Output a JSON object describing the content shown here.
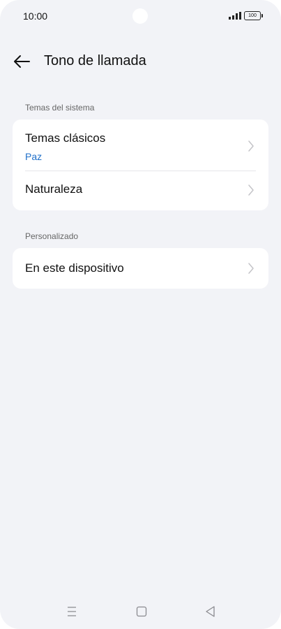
{
  "status_bar": {
    "time": "10:00",
    "battery": "100"
  },
  "header": {
    "title": "Tono de llamada"
  },
  "sections": [
    {
      "label": "Temas del sistema",
      "items": [
        {
          "title": "Temas clásicos",
          "subtitle": "Paz"
        },
        {
          "title": "Naturaleza"
        }
      ]
    },
    {
      "label": "Personalizado",
      "items": [
        {
          "title": "En este dispositivo"
        }
      ]
    }
  ],
  "colors": {
    "background": "#f2f3f7",
    "card": "#ffffff",
    "accent": "#1f6fc9"
  },
  "icons": {
    "back": "arrow-left-icon",
    "chevron": "chevron-right-icon",
    "nav_menu": "menu-icon",
    "nav_home": "home-square-icon",
    "nav_back": "triangle-back-icon"
  }
}
